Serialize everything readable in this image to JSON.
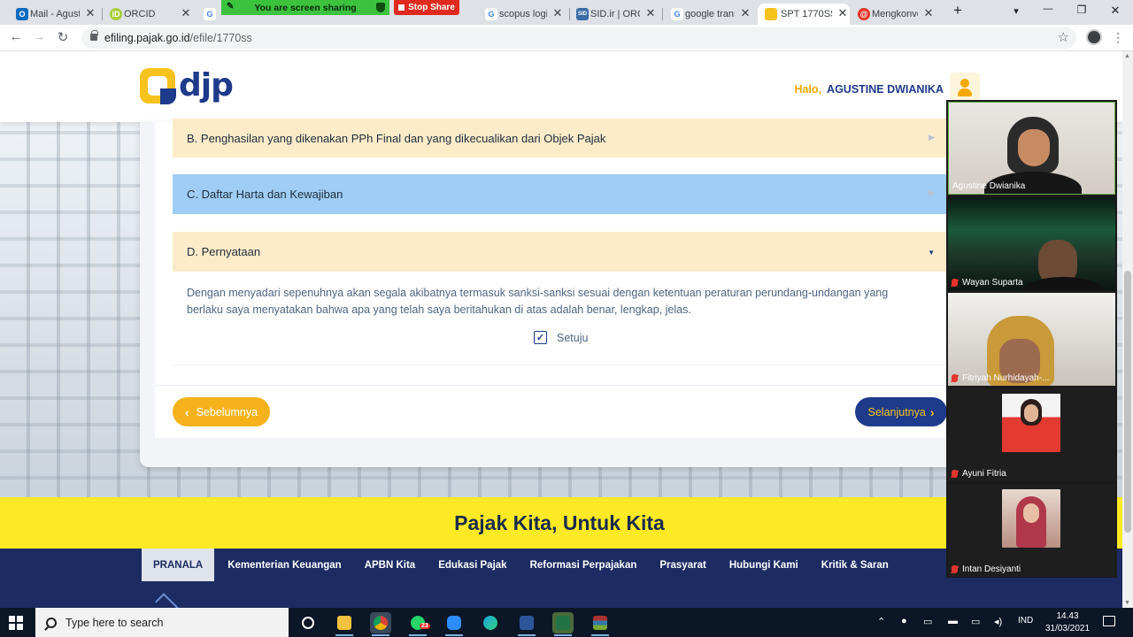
{
  "browser": {
    "tabs": [
      {
        "label": "Mail - Agustine",
        "favicon_color": "#0f6cbd",
        "favicon_glyph": "O"
      },
      {
        "label": "ORCID",
        "favicon_color": "#a6ce39",
        "favicon_glyph": "iD"
      },
      {
        "label": "",
        "favicon_color": "#4285f4",
        "favicon_glyph": "G"
      },
      {
        "label": "scopus login",
        "favicon_color": "#4285f4",
        "favicon_glyph": "G"
      },
      {
        "label": "SID.ir | ORG",
        "favicon_color": "#3a6ea5",
        "favicon_glyph": "SID"
      },
      {
        "label": "google trans",
        "favicon_color": "#4285f4",
        "favicon_glyph": "G"
      },
      {
        "label": "SPT 1770SS",
        "favicon_color": "#f6c21c",
        "favicon_glyph": ""
      },
      {
        "label": "Mengkonve",
        "favicon_color": "#e5352c",
        "favicon_glyph": "@"
      }
    ],
    "close_glyph": "✕",
    "new_tab_glyph": "+",
    "screen_share_banner": "You are screen sharing",
    "stop_share_label": "Stop Share",
    "url_host": "efiling.pajak.go.id",
    "url_path": "/efile/1770ss",
    "window_controls": {
      "minimize": "—",
      "maximize": "❐",
      "close": "✕"
    },
    "nav": {
      "back": "←",
      "forward": "→",
      "reload": "↻",
      "star": "☆",
      "menu": "⋮",
      "tab_menu": "▾"
    }
  },
  "site": {
    "logo_text": "djp",
    "greeting_hello": "Halo,",
    "user_name": "AGUSTINE DWIANIKA",
    "sections": {
      "b_title": "B. Penghasilan yang dikenakan PPh Final dan yang dikecualikan dari Objek Pajak",
      "c_title": "C. Daftar Harta dan Kewajiban",
      "d_title": "D. Pernyataan"
    },
    "statement": "Dengan menyadari sepenuhnya akan segala akibatnya termasuk sanksi-sanksi sesuai dengan ketentuan peraturan perundang-undangan yang berlaku saya menyatakan bahwa apa yang telah saya beritahukan di atas adalah benar, lengkap, jelas.",
    "agree_label": "Setuju",
    "agree_checked": true,
    "prev_label": "Sebelumnya",
    "next_label": "Selanjutnya",
    "slogan": "Pajak Kita, Untuk Kita",
    "footer_nav": [
      "PRANALA",
      "Kementerian Keuangan",
      "APBN Kita",
      "Edukasi Pajak",
      "Reformasi Perpajakan",
      "Prasyarat",
      "Hubungi Kami",
      "Kritik & Saran"
    ]
  },
  "zoom": {
    "participants": [
      {
        "name": "Agustine Dwianika",
        "muted": false
      },
      {
        "name": "Wayan Suparta",
        "muted": true
      },
      {
        "name": "Fitriyah Nurhidayah-...",
        "muted": true
      },
      {
        "name": "Ayuni Fitria",
        "muted": true
      },
      {
        "name": "Intan Desiyanti",
        "muted": true
      }
    ]
  },
  "taskbar": {
    "search_placeholder": "Type here to search",
    "whatsapp_badge": "23",
    "language": "IND",
    "time": "14.43",
    "date": "31/03/2021"
  },
  "colors": {
    "brand_blue": "#1e3a8a",
    "brand_yellow": "#f6c21c",
    "section_b_bg": "#fdebc9",
    "section_c_bg": "#9fcdf5",
    "slogan_bg": "#fdea24",
    "footer_bg": "#1c2c63"
  }
}
